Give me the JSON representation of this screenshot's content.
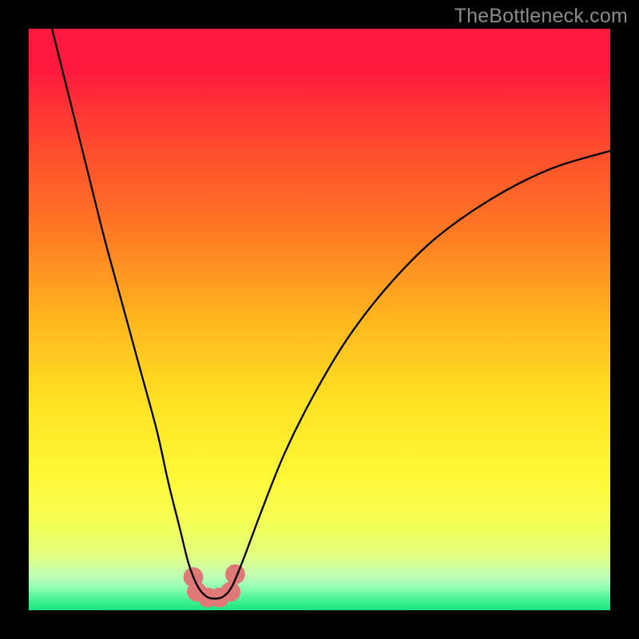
{
  "watermark": "TheBottleneck.com",
  "chart_data": {
    "type": "line",
    "title": "",
    "xlabel": "",
    "ylabel": "",
    "xlim": [
      0,
      100
    ],
    "ylim": [
      0,
      100
    ],
    "grid": false,
    "background_gradient_stops": [
      {
        "offset": 0.0,
        "color": "#ff1a3f"
      },
      {
        "offset": 0.07,
        "color": "#ff1a3d"
      },
      {
        "offset": 0.2,
        "color": "#ff4a2e"
      },
      {
        "offset": 0.35,
        "color": "#ff7a24"
      },
      {
        "offset": 0.5,
        "color": "#ffb61e"
      },
      {
        "offset": 0.65,
        "color": "#ffe424"
      },
      {
        "offset": 0.78,
        "color": "#fff93a"
      },
      {
        "offset": 0.86,
        "color": "#f2ff5c"
      },
      {
        "offset": 0.905,
        "color": "#e3ff80"
      },
      {
        "offset": 0.925,
        "color": "#d2ffa0"
      },
      {
        "offset": 0.945,
        "color": "#b8ffb8"
      },
      {
        "offset": 0.962,
        "color": "#8cffb0"
      },
      {
        "offset": 0.978,
        "color": "#52f59a"
      },
      {
        "offset": 1.0,
        "color": "#18e47e"
      }
    ],
    "series": [
      {
        "name": "bottleneck-curve",
        "stroke": "#000000",
        "stroke_width": 2,
        "points": [
          {
            "x": 4.0,
            "y": 100.0
          },
          {
            "x": 7.0,
            "y": 88.0
          },
          {
            "x": 10.0,
            "y": 76.0
          },
          {
            "x": 13.0,
            "y": 64.0
          },
          {
            "x": 16.0,
            "y": 53.0
          },
          {
            "x": 19.0,
            "y": 42.0
          },
          {
            "x": 22.0,
            "y": 31.0
          },
          {
            "x": 24.0,
            "y": 22.0
          },
          {
            "x": 26.0,
            "y": 14.0
          },
          {
            "x": 27.5,
            "y": 8.0
          },
          {
            "x": 29.0,
            "y": 4.2
          },
          {
            "x": 30.5,
            "y": 2.4
          },
          {
            "x": 32.0,
            "y": 2.0
          },
          {
            "x": 33.5,
            "y": 2.4
          },
          {
            "x": 35.0,
            "y": 4.2
          },
          {
            "x": 37.0,
            "y": 9.0
          },
          {
            "x": 40.0,
            "y": 17.0
          },
          {
            "x": 44.0,
            "y": 27.0
          },
          {
            "x": 49.0,
            "y": 37.0
          },
          {
            "x": 55.0,
            "y": 47.0
          },
          {
            "x": 62.0,
            "y": 56.0
          },
          {
            "x": 70.0,
            "y": 64.0
          },
          {
            "x": 80.0,
            "y": 71.0
          },
          {
            "x": 90.0,
            "y": 76.0
          },
          {
            "x": 100.0,
            "y": 79.0
          }
        ]
      },
      {
        "name": "highlight-markers",
        "type": "scatter",
        "color": "#e07878",
        "radius_pct": 1.7,
        "points": [
          {
            "x": 28.3,
            "y": 5.7
          },
          {
            "x": 28.9,
            "y": 3.2
          },
          {
            "x": 30.8,
            "y": 2.2
          },
          {
            "x": 32.8,
            "y": 2.2
          },
          {
            "x": 34.7,
            "y": 3.2
          },
          {
            "x": 35.5,
            "y": 6.2
          }
        ]
      }
    ]
  }
}
